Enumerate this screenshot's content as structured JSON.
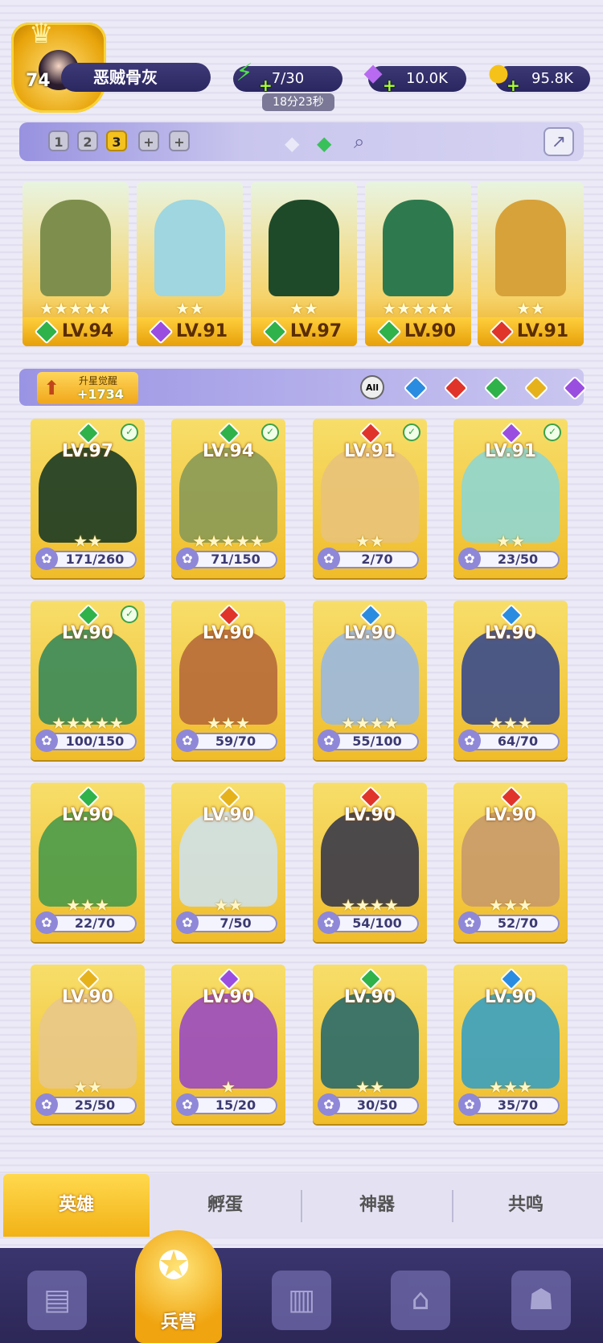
{
  "player": {
    "level": "74",
    "name": "恶贼骨灰"
  },
  "resources": {
    "energy": "7/30",
    "energy_timer": "18分23秒",
    "gems": "10.0K",
    "coins": "95.8K"
  },
  "team_slots": [
    "1",
    "2",
    "3",
    "+",
    "+"
  ],
  "active_slot_index": 2,
  "lineup": [
    {
      "level": "LV.94",
      "element_color": "#2fb24a",
      "stars": "★★★★★",
      "art_color": "#7e8f4d"
    },
    {
      "level": "LV.91",
      "element_color": "#9a4ee0",
      "stars": "★★",
      "art_color": "#9fd6e0"
    },
    {
      "level": "LV.97",
      "element_color": "#2fb24a",
      "stars": "★★",
      "art_color": "#1f4a2a"
    },
    {
      "level": "LV.90",
      "element_color": "#2fb24a",
      "stars": "★★★★★",
      "art_color": "#2e7a4e"
    },
    {
      "level": "LV.91",
      "element_color": "#e0342a",
      "stars": "★★",
      "art_color": "#d7a23a"
    }
  ],
  "awaken": {
    "label": "升星觉醒",
    "value": "+1734"
  },
  "filters": {
    "all_label": "All",
    "colors": [
      "#2a8ce0",
      "#e0342a",
      "#2fb24a",
      "#e6b21c",
      "#9a4ee0"
    ]
  },
  "heroes": [
    {
      "level": "LV.97",
      "shards": "171/260",
      "stars": "★★",
      "gem": "#2fb24a",
      "checked": true,
      "art": "#1b3a24"
    },
    {
      "level": "LV.94",
      "shards": "71/150",
      "stars": "★★★★★",
      "gem": "#2fb24a",
      "checked": true,
      "art": "#8a9a56"
    },
    {
      "level": "LV.91",
      "shards": "2/70",
      "stars": "★★",
      "gem": "#e0342a",
      "checked": true,
      "art": "#e9c27a"
    },
    {
      "level": "LV.91",
      "shards": "23/50",
      "stars": "★★",
      "gem": "#9a4ee0",
      "checked": true,
      "art": "#8fd6d0"
    },
    {
      "level": "LV.90",
      "shards": "100/150",
      "stars": "★★★★★",
      "gem": "#2fb24a",
      "checked": true,
      "art": "#3a8a5a"
    },
    {
      "level": "LV.90",
      "shards": "59/70",
      "stars": "★★★",
      "gem": "#e0342a",
      "checked": false,
      "art": "#b76a3a"
    },
    {
      "level": "LV.90",
      "shards": "55/100",
      "stars": "★★★★",
      "gem": "#2a8ce0",
      "checked": false,
      "art": "#9ab8e0"
    },
    {
      "level": "LV.90",
      "shards": "64/70",
      "stars": "★★★",
      "gem": "#2a8ce0",
      "checked": false,
      "art": "#3a4a8a"
    },
    {
      "level": "LV.90",
      "shards": "22/70",
      "stars": "★★★",
      "gem": "#2fb24a",
      "checked": false,
      "art": "#4a9a4a"
    },
    {
      "level": "LV.90",
      "shards": "7/50",
      "stars": "★★",
      "gem": "#e6b21c",
      "checked": false,
      "art": "#cfe0e8"
    },
    {
      "level": "LV.90",
      "shards": "54/100",
      "stars": "★★★★",
      "gem": "#e0342a",
      "checked": false,
      "art": "#3a3a4a"
    },
    {
      "level": "LV.90",
      "shards": "52/70",
      "stars": "★★★",
      "gem": "#e0342a",
      "checked": false,
      "art": "#c89a6a"
    },
    {
      "level": "LV.90",
      "shards": "25/50",
      "stars": "★★",
      "gem": "#e6b21c",
      "checked": false,
      "art": "#e8c88a"
    },
    {
      "level": "LV.90",
      "shards": "15/20",
      "stars": "★",
      "gem": "#9a4ee0",
      "checked": false,
      "art": "#9a4ac0"
    },
    {
      "level": "LV.90",
      "shards": "30/50",
      "stars": "★★",
      "gem": "#2fb24a",
      "checked": false,
      "art": "#2a6a6a"
    },
    {
      "level": "LV.90",
      "shards": "35/70",
      "stars": "★★★",
      "gem": "#2a8ce0",
      "checked": false,
      "art": "#3aa0c0"
    }
  ],
  "subtabs": [
    "英雄",
    "孵蛋",
    "神器",
    "共鸣"
  ],
  "nav": {
    "active_label": "兵营",
    "items": [
      "cards-icon",
      "book-icon",
      "shop-icon",
      "guild-icon"
    ]
  }
}
